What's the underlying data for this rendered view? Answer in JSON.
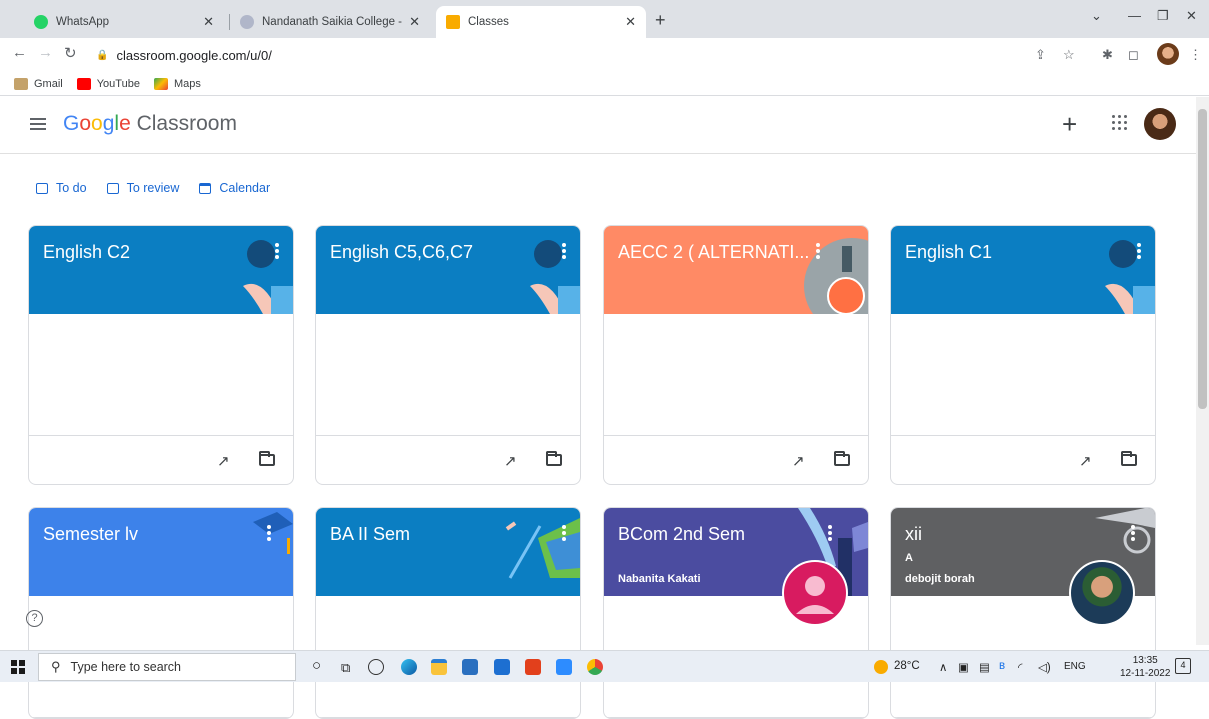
{
  "browser": {
    "tabs": [
      {
        "title": "WhatsApp",
        "favicon_color": "#25d366"
      },
      {
        "title": "Nandanath Saikia College - Orga",
        "favicon_color": "#b0b6c9"
      },
      {
        "title": "Classes",
        "favicon_color": "#f9ab00",
        "active": true
      }
    ],
    "url": "classroom.google.com/u/0/",
    "bookmarks": [
      {
        "label": "Gmail",
        "color": "#c4a26a"
      },
      {
        "label": "YouTube",
        "color": "#ff0000"
      },
      {
        "label": "Maps",
        "color": "#34a853"
      }
    ]
  },
  "header": {
    "brand_google": [
      "G",
      "o",
      "o",
      "g",
      "l",
      "e"
    ],
    "brand_product": " Classroom"
  },
  "quick_links": [
    {
      "label": "To do"
    },
    {
      "label": "To review"
    },
    {
      "label": "Calendar"
    }
  ],
  "classes": [
    {
      "title": "English C2",
      "section": "",
      "teacher": "",
      "color": "#0b7ec2"
    },
    {
      "title": "English C5,C6,C7",
      "section": "",
      "teacher": "",
      "color": "#0b7ec2"
    },
    {
      "title": "AECC 2 ( ALTERNATI...",
      "section": "",
      "teacher": "",
      "color": "#ff8a65"
    },
    {
      "title": "English C1",
      "section": "",
      "teacher": "",
      "color": "#0b7ec2"
    },
    {
      "title": "Semester lv",
      "section": "",
      "teacher": "",
      "color": "#3d82ea"
    },
    {
      "title": "BA II Sem",
      "section": "",
      "teacher": "",
      "color": "#0b7ec2"
    },
    {
      "title": "BCom 2nd Sem",
      "section": "",
      "teacher": "Nabanita Kakati",
      "color": "#4b4ca0"
    },
    {
      "title": "xii",
      "section": "A",
      "teacher": "debojit borah",
      "color": "#5f6062"
    }
  ],
  "taskbar": {
    "search_placeholder": "Type here to search",
    "weather": "28°C",
    "language": "ENG",
    "time": "13:35",
    "date": "12-11-2022",
    "notifications": "4"
  }
}
